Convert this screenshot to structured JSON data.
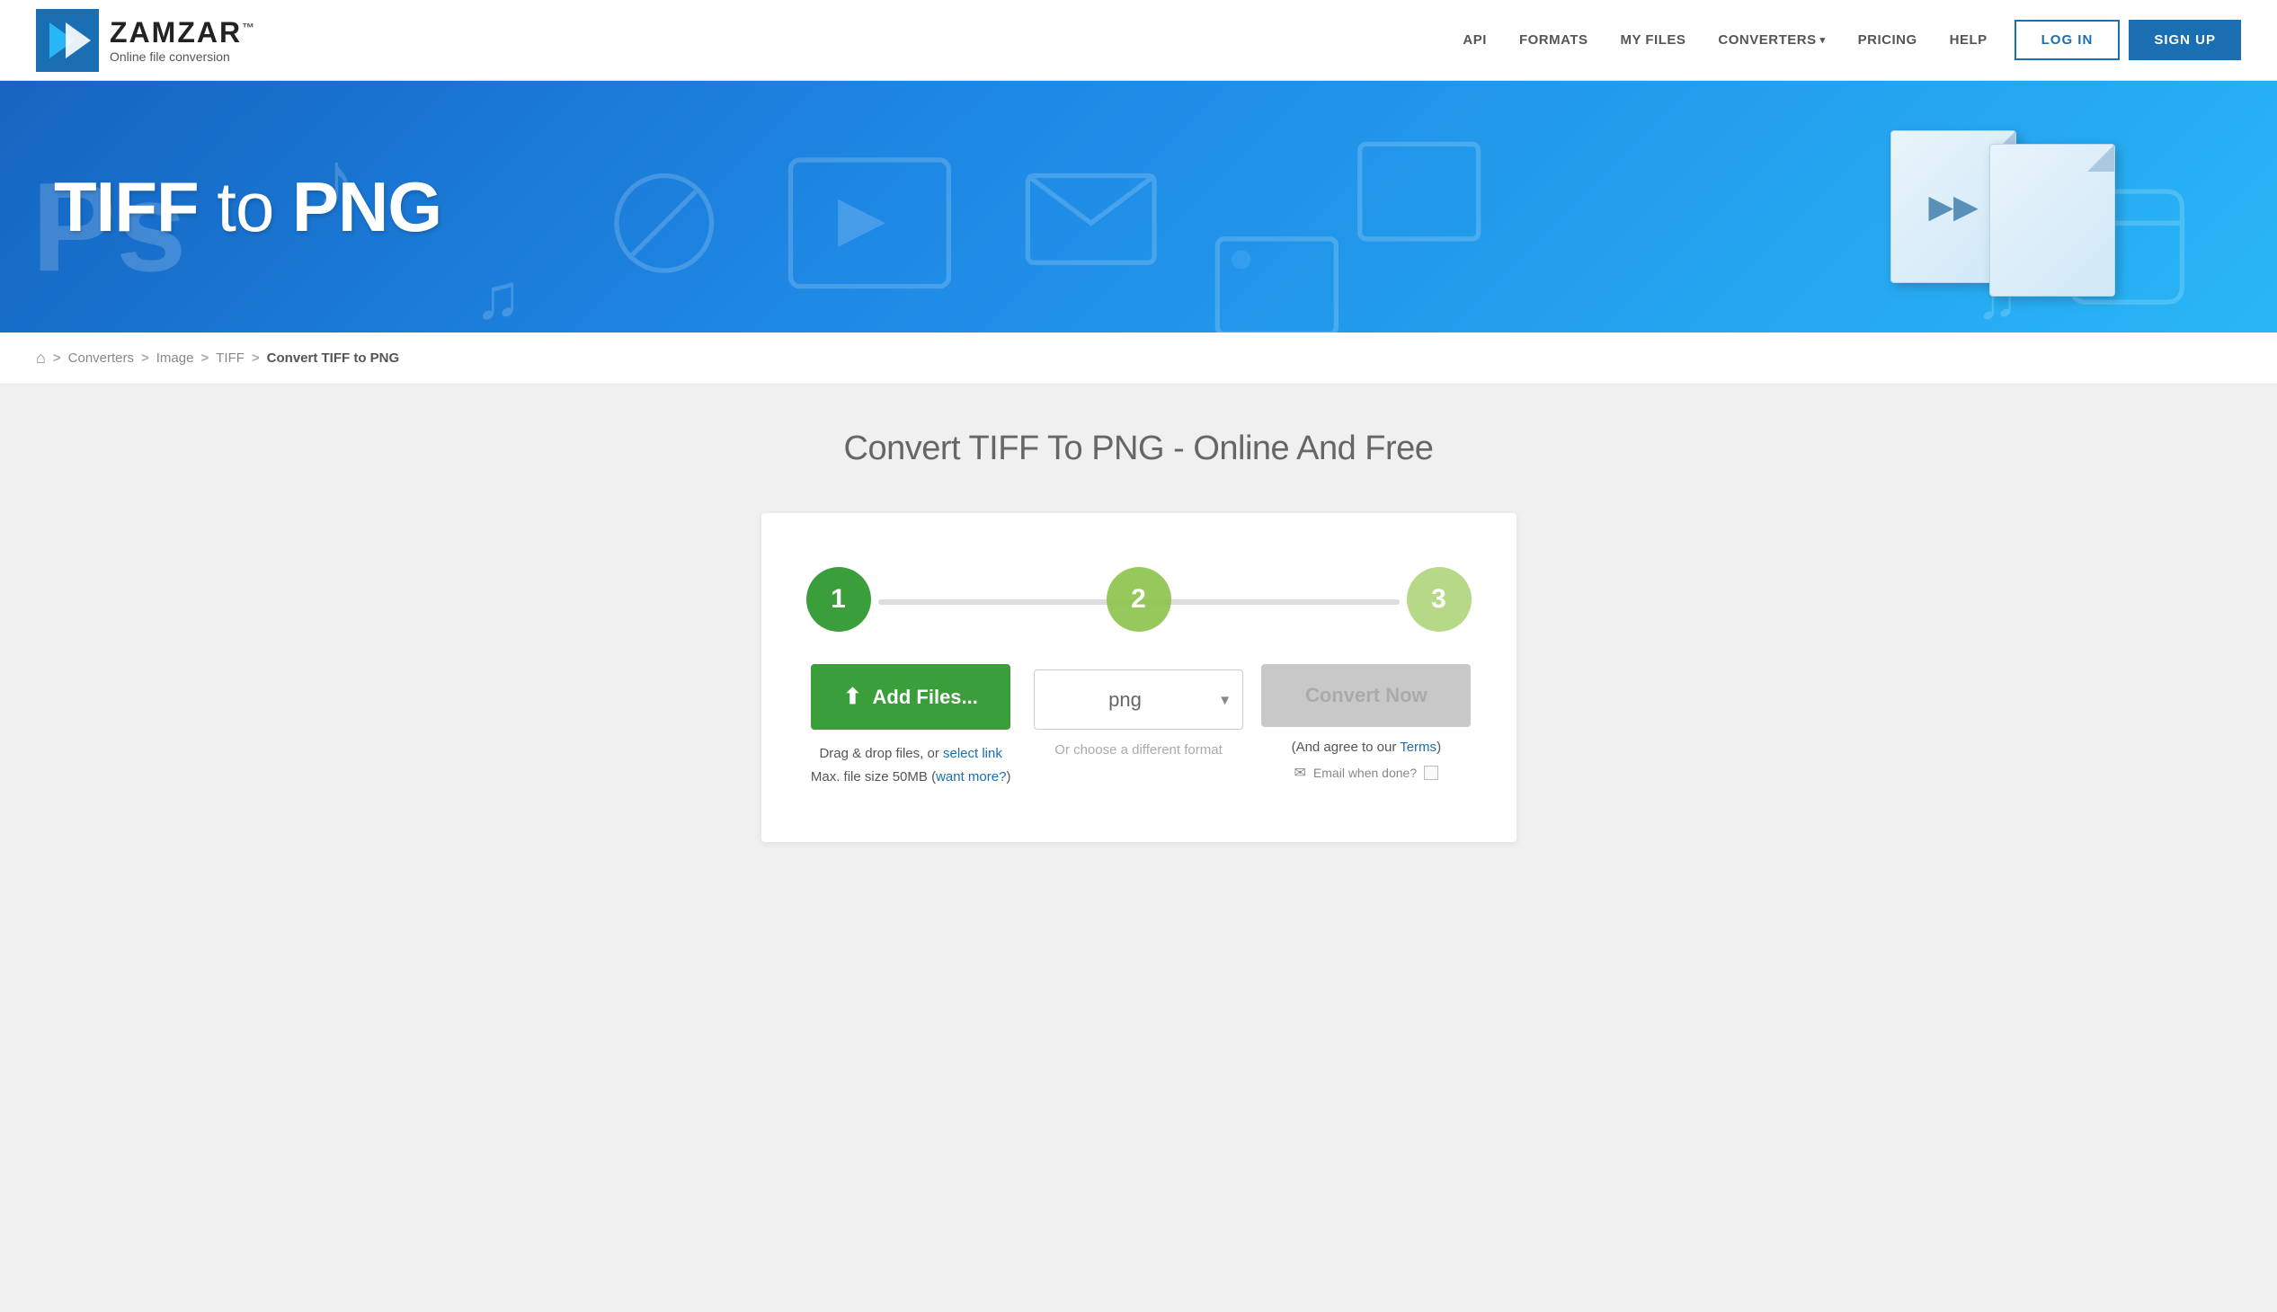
{
  "header": {
    "logo_name": "ZAMZAR",
    "logo_tm": "™",
    "logo_subtitle": "Online file conversion",
    "nav": {
      "api": "API",
      "formats": "FORMATS",
      "my_files": "MY FILES",
      "converters": "CONVERTERS",
      "pricing": "PRICING",
      "help": "HELP"
    },
    "btn_login": "LOG IN",
    "btn_signup": "SIGN UP"
  },
  "hero": {
    "title_part1": "TIFF",
    "title_to": " to ",
    "title_part2": "PNG"
  },
  "breadcrumb": {
    "home_icon": "⌂",
    "sep1": ">",
    "converters": "Converters",
    "sep2": ">",
    "image": "Image",
    "sep3": ">",
    "tiff": "TIFF",
    "sep4": ">",
    "current": "Convert TIFF to PNG"
  },
  "page_title": "Convert TIFF To PNG - Online And Free",
  "converter": {
    "step1_number": "1",
    "step2_number": "2",
    "step3_number": "3",
    "add_files_label": "Add Files...",
    "upload_icon": "↑",
    "drop_text_line1": "Drag & drop files, or",
    "select_link": "select link",
    "drop_text_line2": "Max. file size 50MB (",
    "want_more_link": "want more?",
    "drop_text_end": ")",
    "format_value": "png",
    "or_format": "Or choose a different format",
    "convert_now": "Convert Now",
    "agree_text_prefix": "(And agree to our ",
    "terms_link": "Terms",
    "agree_text_suffix": ")",
    "email_label": "Email when done?",
    "email_icon": "✉"
  }
}
